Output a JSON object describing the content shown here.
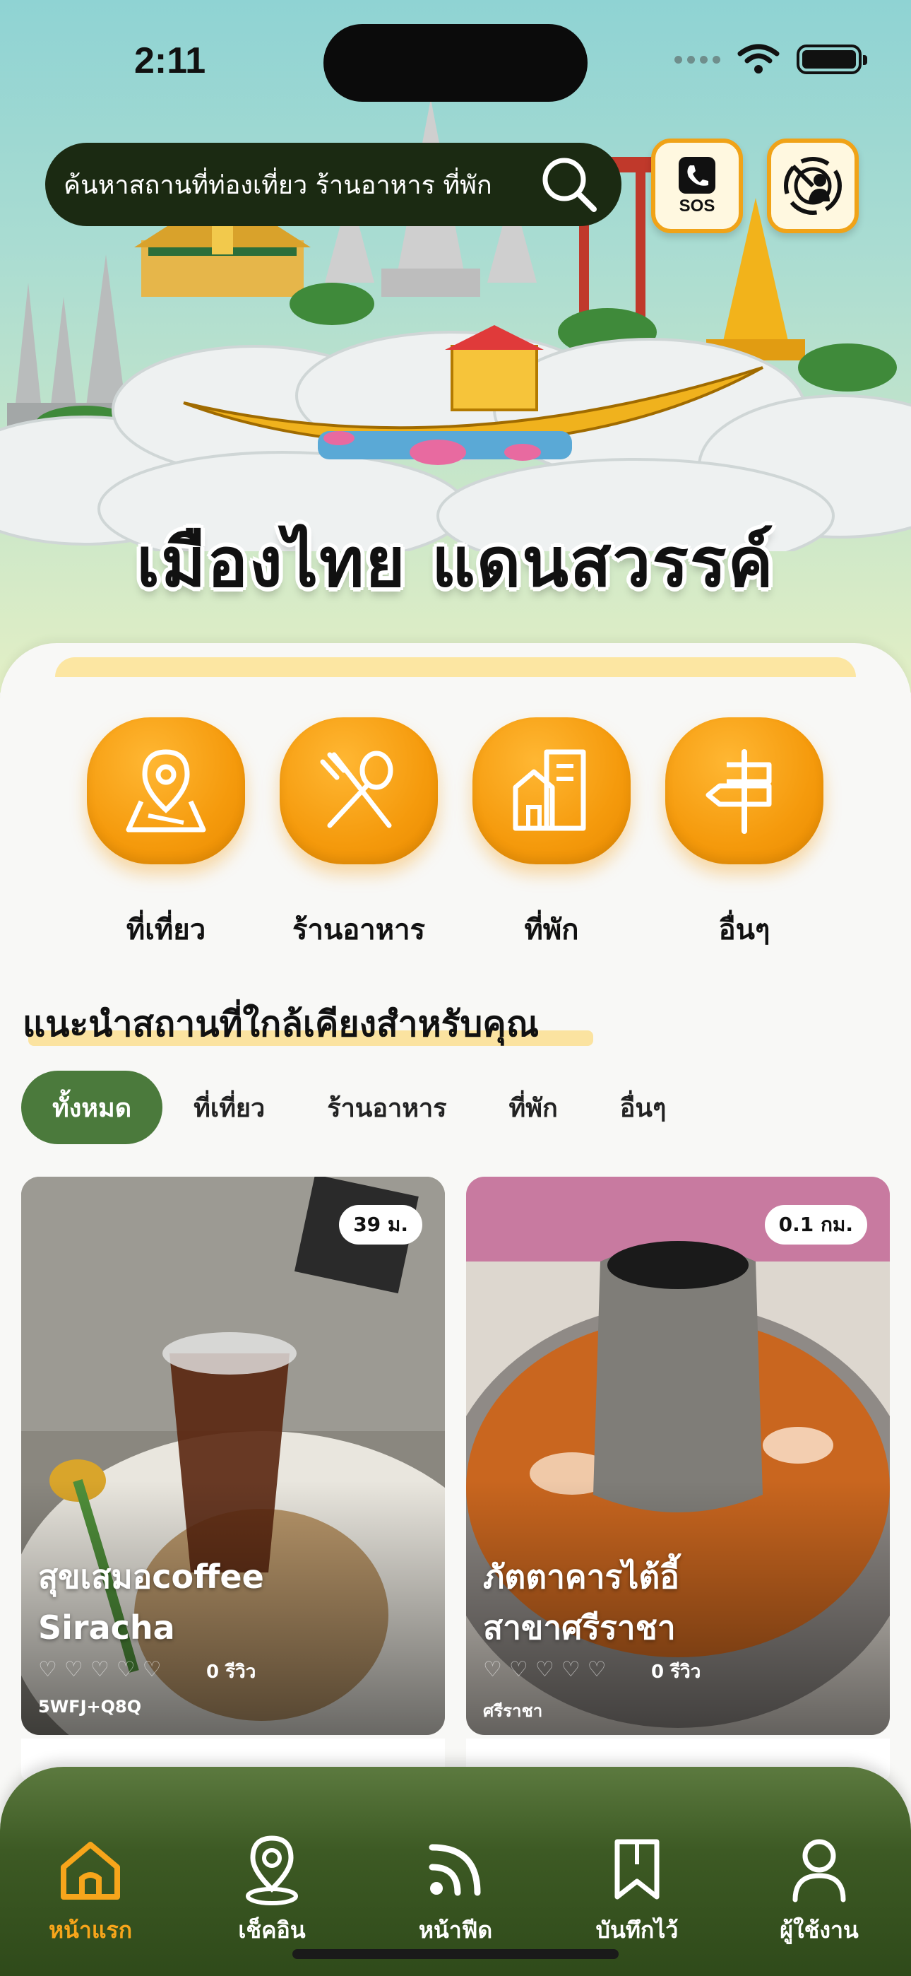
{
  "status_bar": {
    "time": "2:11"
  },
  "search": {
    "placeholder": "ค้นหาสถานที่ท่องเที่ยว ร้านอาหาร ที่พัก"
  },
  "header_buttons": {
    "sos_label": "SOS"
  },
  "brand": {
    "title": "เมืองไทย แดนสวรรค์"
  },
  "categories": [
    {
      "label": "ที่เที่ยว",
      "icon": "map-pin-icon"
    },
    {
      "label": "ร้านอาหาร",
      "icon": "fork-spoon-icon"
    },
    {
      "label": "ที่พัก",
      "icon": "building-icon"
    },
    {
      "label": "อื่นๆ",
      "icon": "signpost-icon"
    }
  ],
  "section": {
    "title": "แนะนำสถานที่ใกล้เคียงสำหรับคุณ"
  },
  "filters": [
    {
      "label": "ทั้งหมด",
      "active": true
    },
    {
      "label": "ที่เที่ยว",
      "active": false
    },
    {
      "label": "ร้านอาหาร",
      "active": false
    },
    {
      "label": "ที่พัก",
      "active": false
    },
    {
      "label": "อื่นๆ",
      "active": false
    }
  ],
  "cards": [
    {
      "name_line1": "สุขเสมอcoffee",
      "name_line2": "Siracha",
      "distance": "39 ม.",
      "reviews": "0 รีวิว",
      "location": "5WFJ+Q8Q",
      "rating": 0
    },
    {
      "name_line1": "ภัตตาคารไต้อี้",
      "name_line2": "สาขาศรีราชา",
      "distance": "0.1 กม.",
      "reviews": "0 รีวิว",
      "location": "ศรีราชา",
      "rating": 0
    }
  ],
  "tabs": [
    {
      "label": "หน้าแรก",
      "icon": "home-icon",
      "active": true
    },
    {
      "label": "เช็คอิน",
      "icon": "checkin-pin-icon",
      "active": false
    },
    {
      "label": "หน้าฟีด",
      "icon": "feed-icon",
      "active": false
    },
    {
      "label": "บันทึกไว้",
      "icon": "bookmark-icon",
      "active": false
    },
    {
      "label": "ผู้ใช้งาน",
      "icon": "user-icon",
      "active": false
    }
  ],
  "colors": {
    "accent": "#f59a0c",
    "green": "#4b7a3c",
    "tabbar": "#3d5a24"
  }
}
